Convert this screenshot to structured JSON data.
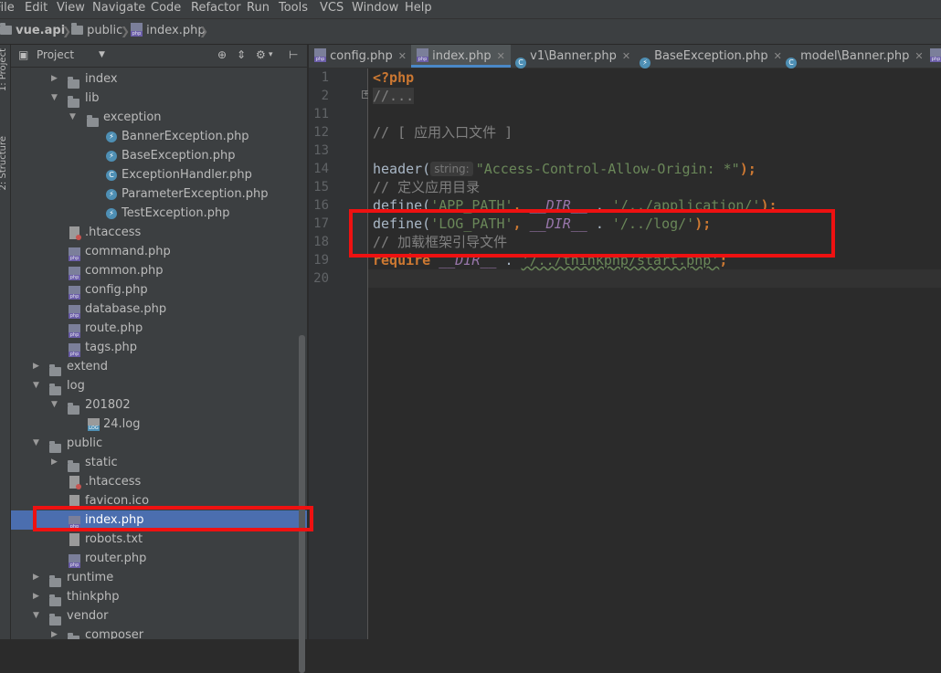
{
  "menu": [
    "File",
    "Edit",
    "View",
    "Navigate",
    "Code",
    "Refactor",
    "Run",
    "Tools",
    "VCS",
    "Window",
    "Help"
  ],
  "breadcrumb": {
    "project": "vue.api",
    "folder": "public",
    "file": "index.php"
  },
  "left_strip": {
    "project_tab": "1: Project",
    "structure_tab": "2: Structure"
  },
  "project_panel": {
    "title": "Project"
  },
  "tree": [
    {
      "label": "index",
      "type": "folder",
      "expanded": false
    },
    {
      "label": "lib",
      "type": "folder",
      "expanded": true
    },
    {
      "label": "exception",
      "type": "folder",
      "expanded": true
    },
    {
      "label": "BannerException.php",
      "type": "php-class"
    },
    {
      "label": "BaseException.php",
      "type": "php-class"
    },
    {
      "label": "ExceptionHandler.php",
      "type": "php-class-c"
    },
    {
      "label": "ParameterException.php",
      "type": "php-class"
    },
    {
      "label": "TestException.php",
      "type": "php-class"
    },
    {
      "label": ".htaccess",
      "type": "htaccess"
    },
    {
      "label": "command.php",
      "type": "php"
    },
    {
      "label": "common.php",
      "type": "php"
    },
    {
      "label": "config.php",
      "type": "php"
    },
    {
      "label": "database.php",
      "type": "php"
    },
    {
      "label": "route.php",
      "type": "php"
    },
    {
      "label": "tags.php",
      "type": "php"
    },
    {
      "label": "extend",
      "type": "folder",
      "expanded": false
    },
    {
      "label": "log",
      "type": "folder",
      "expanded": true
    },
    {
      "label": "201802",
      "type": "folder",
      "expanded": true
    },
    {
      "label": "24.log",
      "type": "log"
    },
    {
      "label": "public",
      "type": "folder",
      "expanded": true
    },
    {
      "label": "static",
      "type": "folder",
      "expanded": false
    },
    {
      "label": ".htaccess",
      "type": "htaccess"
    },
    {
      "label": "favicon.ico",
      "type": "ico"
    },
    {
      "label": "index.php",
      "type": "php",
      "selected": true
    },
    {
      "label": "robots.txt",
      "type": "file"
    },
    {
      "label": "router.php",
      "type": "php"
    },
    {
      "label": "runtime",
      "type": "folder",
      "expanded": false
    },
    {
      "label": "thinkphp",
      "type": "folder",
      "expanded": false
    },
    {
      "label": "vendor",
      "type": "folder",
      "expanded": true
    },
    {
      "label": "composer",
      "type": "folder",
      "expanded": false
    }
  ],
  "tabs": [
    {
      "label": "config.php",
      "icon": "php",
      "active": false
    },
    {
      "label": "index.php",
      "icon": "php",
      "active": true
    },
    {
      "label": "v1\\Banner.php",
      "icon": "class",
      "active": false
    },
    {
      "label": "BaseException.php",
      "icon": "class-lightning",
      "active": false
    },
    {
      "label": "model\\Banner.php",
      "icon": "class",
      "active": false
    }
  ],
  "line_numbers": [
    "1",
    "2",
    "11",
    "12",
    "13",
    "14",
    "15",
    "16",
    "17",
    "18",
    "19",
    "20"
  ],
  "code": {
    "l1": "<?php",
    "l2": "//...",
    "l12": "// [ 应用入口文件 ]",
    "l14_fn": "header(",
    "l14_hint": "string:",
    "l14_str": "\"Access-Control-Allow-Origin: *\"",
    "l14_end": ");",
    "l15": "// 定义应用目录",
    "l16_fn": "define(",
    "l16_str1": "'APP_PATH'",
    "l16_mid": ", ",
    "l16_const": "__DIR__",
    "l16_dot": " . ",
    "l16_str2": "'/../application/'",
    "l16_end": ");",
    "l17_fn": "define(",
    "l17_str1": "'LOG_PATH'",
    "l17_mid": ", ",
    "l17_const": "__DIR__",
    "l17_dot": " . ",
    "l17_str2": "'/../log/'",
    "l17_end": ");",
    "l18": "// 加载框架引导文件",
    "l19_kw": "require",
    "l19_sp": " ",
    "l19_const": "__DIR__",
    "l19_dot": " . ",
    "l19_str": "'/../thinkphp/start.php'",
    "l19_end": ";"
  }
}
